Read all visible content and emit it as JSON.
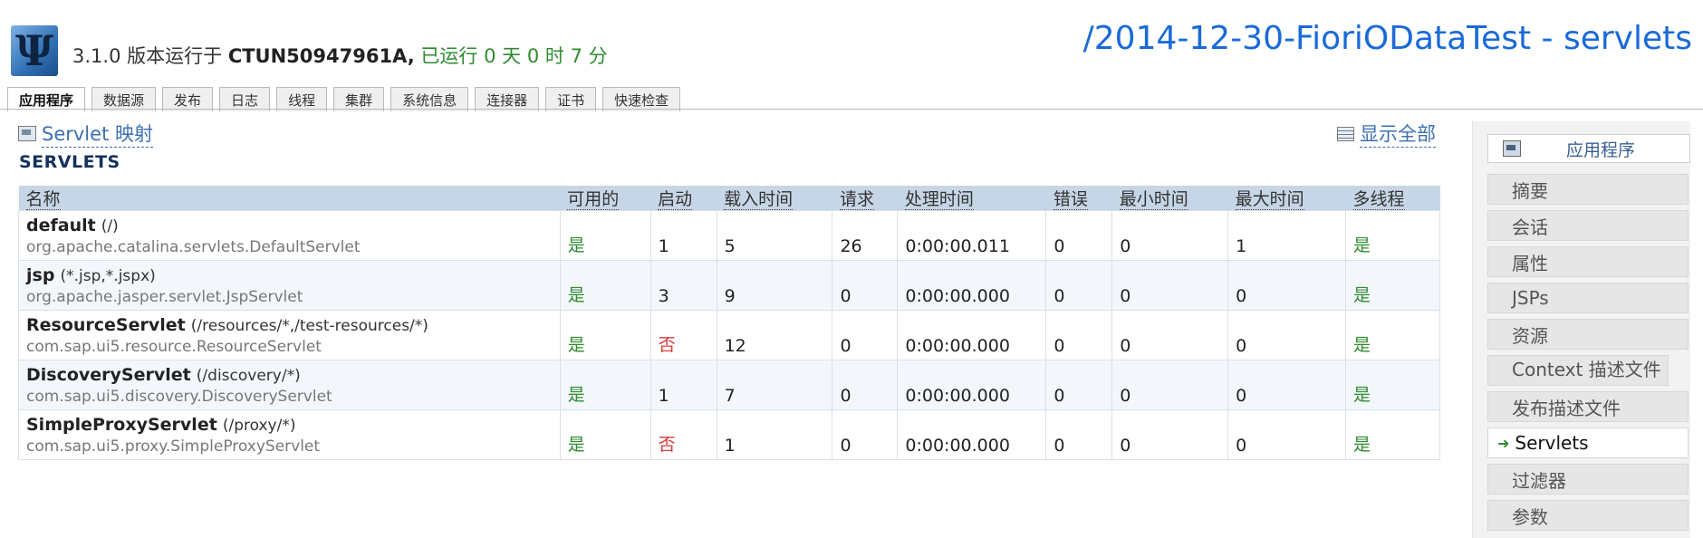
{
  "header": {
    "logo_glyph": "Ψ",
    "version": "3.1.0",
    "running_on_label": "版本运行于",
    "host": "CTUN50947961A",
    "uptime_label": "已运行",
    "uptime_days": "0",
    "days_label": "天",
    "uptime_hours": "0",
    "hours_label": "时",
    "uptime_minutes": "7",
    "minutes_label": "分",
    "page_title": "/2014-12-30-FioriODataTest - servlets"
  },
  "tabs": [
    {
      "label": "应用程序",
      "active": true
    },
    {
      "label": "数据源"
    },
    {
      "label": "发布"
    },
    {
      "label": "日志"
    },
    {
      "label": "线程"
    },
    {
      "label": "集群"
    },
    {
      "label": "系统信息"
    },
    {
      "label": "连接器"
    },
    {
      "label": "证书"
    },
    {
      "label": "快速检查"
    }
  ],
  "main": {
    "mapping_link": "Servlet 映射",
    "show_all_link": "显示全部",
    "section_title": "SERVLETS",
    "columns": [
      "名称",
      "可用的",
      "启动",
      "载入时间",
      "请求",
      "处理时间",
      "错误",
      "最小时间",
      "最大时间",
      "多线程"
    ],
    "rows": [
      {
        "name": "default",
        "pattern": "(/)",
        "class": "org.apache.catalina.servlets.DefaultServlet",
        "available": "是",
        "startup": "1",
        "load_time": "5",
        "requests": "26",
        "processing": "0:00:00.011",
        "errors": "0",
        "min_time": "0",
        "max_time": "1",
        "multithreaded": "是"
      },
      {
        "name": "jsp",
        "pattern": "(*.jsp,*.jspx)",
        "class": "org.apache.jasper.servlet.JspServlet",
        "available": "是",
        "startup": "3",
        "load_time": "9",
        "requests": "0",
        "processing": "0:00:00.000",
        "errors": "0",
        "min_time": "0",
        "max_time": "0",
        "multithreaded": "是"
      },
      {
        "name": "ResourceServlet",
        "pattern": "(/resources/*,/test-resources/*)",
        "class": "com.sap.ui5.resource.ResourceServlet",
        "available": "是",
        "startup": "否",
        "load_time": "12",
        "requests": "0",
        "processing": "0:00:00.000",
        "errors": "0",
        "min_time": "0",
        "max_time": "0",
        "multithreaded": "是"
      },
      {
        "name": "DiscoveryServlet",
        "pattern": "(/discovery/*)",
        "class": "com.sap.ui5.discovery.DiscoveryServlet",
        "available": "是",
        "startup": "1",
        "load_time": "7",
        "requests": "0",
        "processing": "0:00:00.000",
        "errors": "0",
        "min_time": "0",
        "max_time": "0",
        "multithreaded": "是"
      },
      {
        "name": "SimpleProxyServlet",
        "pattern": "(/proxy/*)",
        "class": "com.sap.ui5.proxy.SimpleProxyServlet",
        "available": "是",
        "startup": "否",
        "load_time": "1",
        "requests": "0",
        "processing": "0:00:00.000",
        "errors": "0",
        "min_time": "0",
        "max_time": "0",
        "multithreaded": "是"
      }
    ]
  },
  "sidebar": {
    "header": "应用程序",
    "items": [
      {
        "label": "摘要"
      },
      {
        "label": "会话"
      },
      {
        "label": "属性"
      },
      {
        "label": "JSPs"
      },
      {
        "label": "资源"
      },
      {
        "label": "Context 描述文件"
      },
      {
        "label": "发布描述文件"
      },
      {
        "label": "Servlets",
        "active": true
      },
      {
        "label": "过滤器"
      },
      {
        "label": "参数"
      }
    ]
  },
  "colors": {
    "link": "#3b6fb0",
    "title": "#1a6ad8",
    "yes": "#2e8b2e",
    "no": "#d43a3a",
    "table_header": "#c6d6e6"
  }
}
